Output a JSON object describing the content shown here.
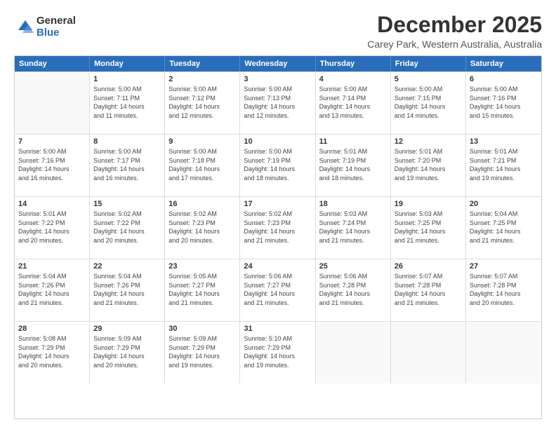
{
  "logo": {
    "general": "General",
    "blue": "Blue"
  },
  "title": "December 2025",
  "subtitle": "Carey Park, Western Australia, Australia",
  "headers": [
    "Sunday",
    "Monday",
    "Tuesday",
    "Wednesday",
    "Thursday",
    "Friday",
    "Saturday"
  ],
  "weeks": [
    [
      {
        "day": "",
        "info": ""
      },
      {
        "day": "1",
        "info": "Sunrise: 5:00 AM\nSunset: 7:11 PM\nDaylight: 14 hours\nand 11 minutes."
      },
      {
        "day": "2",
        "info": "Sunrise: 5:00 AM\nSunset: 7:12 PM\nDaylight: 14 hours\nand 12 minutes."
      },
      {
        "day": "3",
        "info": "Sunrise: 5:00 AM\nSunset: 7:13 PM\nDaylight: 14 hours\nand 12 minutes."
      },
      {
        "day": "4",
        "info": "Sunrise: 5:00 AM\nSunset: 7:14 PM\nDaylight: 14 hours\nand 13 minutes."
      },
      {
        "day": "5",
        "info": "Sunrise: 5:00 AM\nSunset: 7:15 PM\nDaylight: 14 hours\nand 14 minutes."
      },
      {
        "day": "6",
        "info": "Sunrise: 5:00 AM\nSunset: 7:16 PM\nDaylight: 14 hours\nand 15 minutes."
      }
    ],
    [
      {
        "day": "7",
        "info": "Sunrise: 5:00 AM\nSunset: 7:16 PM\nDaylight: 14 hours\nand 16 minutes."
      },
      {
        "day": "8",
        "info": "Sunrise: 5:00 AM\nSunset: 7:17 PM\nDaylight: 14 hours\nand 16 minutes."
      },
      {
        "day": "9",
        "info": "Sunrise: 5:00 AM\nSunset: 7:18 PM\nDaylight: 14 hours\nand 17 minutes."
      },
      {
        "day": "10",
        "info": "Sunrise: 5:00 AM\nSunset: 7:19 PM\nDaylight: 14 hours\nand 18 minutes."
      },
      {
        "day": "11",
        "info": "Sunrise: 5:01 AM\nSunset: 7:19 PM\nDaylight: 14 hours\nand 18 minutes."
      },
      {
        "day": "12",
        "info": "Sunrise: 5:01 AM\nSunset: 7:20 PM\nDaylight: 14 hours\nand 19 minutes."
      },
      {
        "day": "13",
        "info": "Sunrise: 5:01 AM\nSunset: 7:21 PM\nDaylight: 14 hours\nand 19 minutes."
      }
    ],
    [
      {
        "day": "14",
        "info": "Sunrise: 5:01 AM\nSunset: 7:22 PM\nDaylight: 14 hours\nand 20 minutes."
      },
      {
        "day": "15",
        "info": "Sunrise: 5:02 AM\nSunset: 7:22 PM\nDaylight: 14 hours\nand 20 minutes."
      },
      {
        "day": "16",
        "info": "Sunrise: 5:02 AM\nSunset: 7:23 PM\nDaylight: 14 hours\nand 20 minutes."
      },
      {
        "day": "17",
        "info": "Sunrise: 5:02 AM\nSunset: 7:23 PM\nDaylight: 14 hours\nand 21 minutes."
      },
      {
        "day": "18",
        "info": "Sunrise: 5:03 AM\nSunset: 7:24 PM\nDaylight: 14 hours\nand 21 minutes."
      },
      {
        "day": "19",
        "info": "Sunrise: 5:03 AM\nSunset: 7:25 PM\nDaylight: 14 hours\nand 21 minutes."
      },
      {
        "day": "20",
        "info": "Sunrise: 5:04 AM\nSunset: 7:25 PM\nDaylight: 14 hours\nand 21 minutes."
      }
    ],
    [
      {
        "day": "21",
        "info": "Sunrise: 5:04 AM\nSunset: 7:26 PM\nDaylight: 14 hours\nand 21 minutes."
      },
      {
        "day": "22",
        "info": "Sunrise: 5:04 AM\nSunset: 7:26 PM\nDaylight: 14 hours\nand 21 minutes."
      },
      {
        "day": "23",
        "info": "Sunrise: 5:05 AM\nSunset: 7:27 PM\nDaylight: 14 hours\nand 21 minutes."
      },
      {
        "day": "24",
        "info": "Sunrise: 5:06 AM\nSunset: 7:27 PM\nDaylight: 14 hours\nand 21 minutes."
      },
      {
        "day": "25",
        "info": "Sunrise: 5:06 AM\nSunset: 7:28 PM\nDaylight: 14 hours\nand 21 minutes."
      },
      {
        "day": "26",
        "info": "Sunrise: 5:07 AM\nSunset: 7:28 PM\nDaylight: 14 hours\nand 21 minutes."
      },
      {
        "day": "27",
        "info": "Sunrise: 5:07 AM\nSunset: 7:28 PM\nDaylight: 14 hours\nand 20 minutes."
      }
    ],
    [
      {
        "day": "28",
        "info": "Sunrise: 5:08 AM\nSunset: 7:29 PM\nDaylight: 14 hours\nand 20 minutes."
      },
      {
        "day": "29",
        "info": "Sunrise: 5:09 AM\nSunset: 7:29 PM\nDaylight: 14 hours\nand 20 minutes."
      },
      {
        "day": "30",
        "info": "Sunrise: 5:09 AM\nSunset: 7:29 PM\nDaylight: 14 hours\nand 19 minutes."
      },
      {
        "day": "31",
        "info": "Sunrise: 5:10 AM\nSunset: 7:29 PM\nDaylight: 14 hours\nand 19 minutes."
      },
      {
        "day": "",
        "info": ""
      },
      {
        "day": "",
        "info": ""
      },
      {
        "day": "",
        "info": ""
      }
    ]
  ]
}
